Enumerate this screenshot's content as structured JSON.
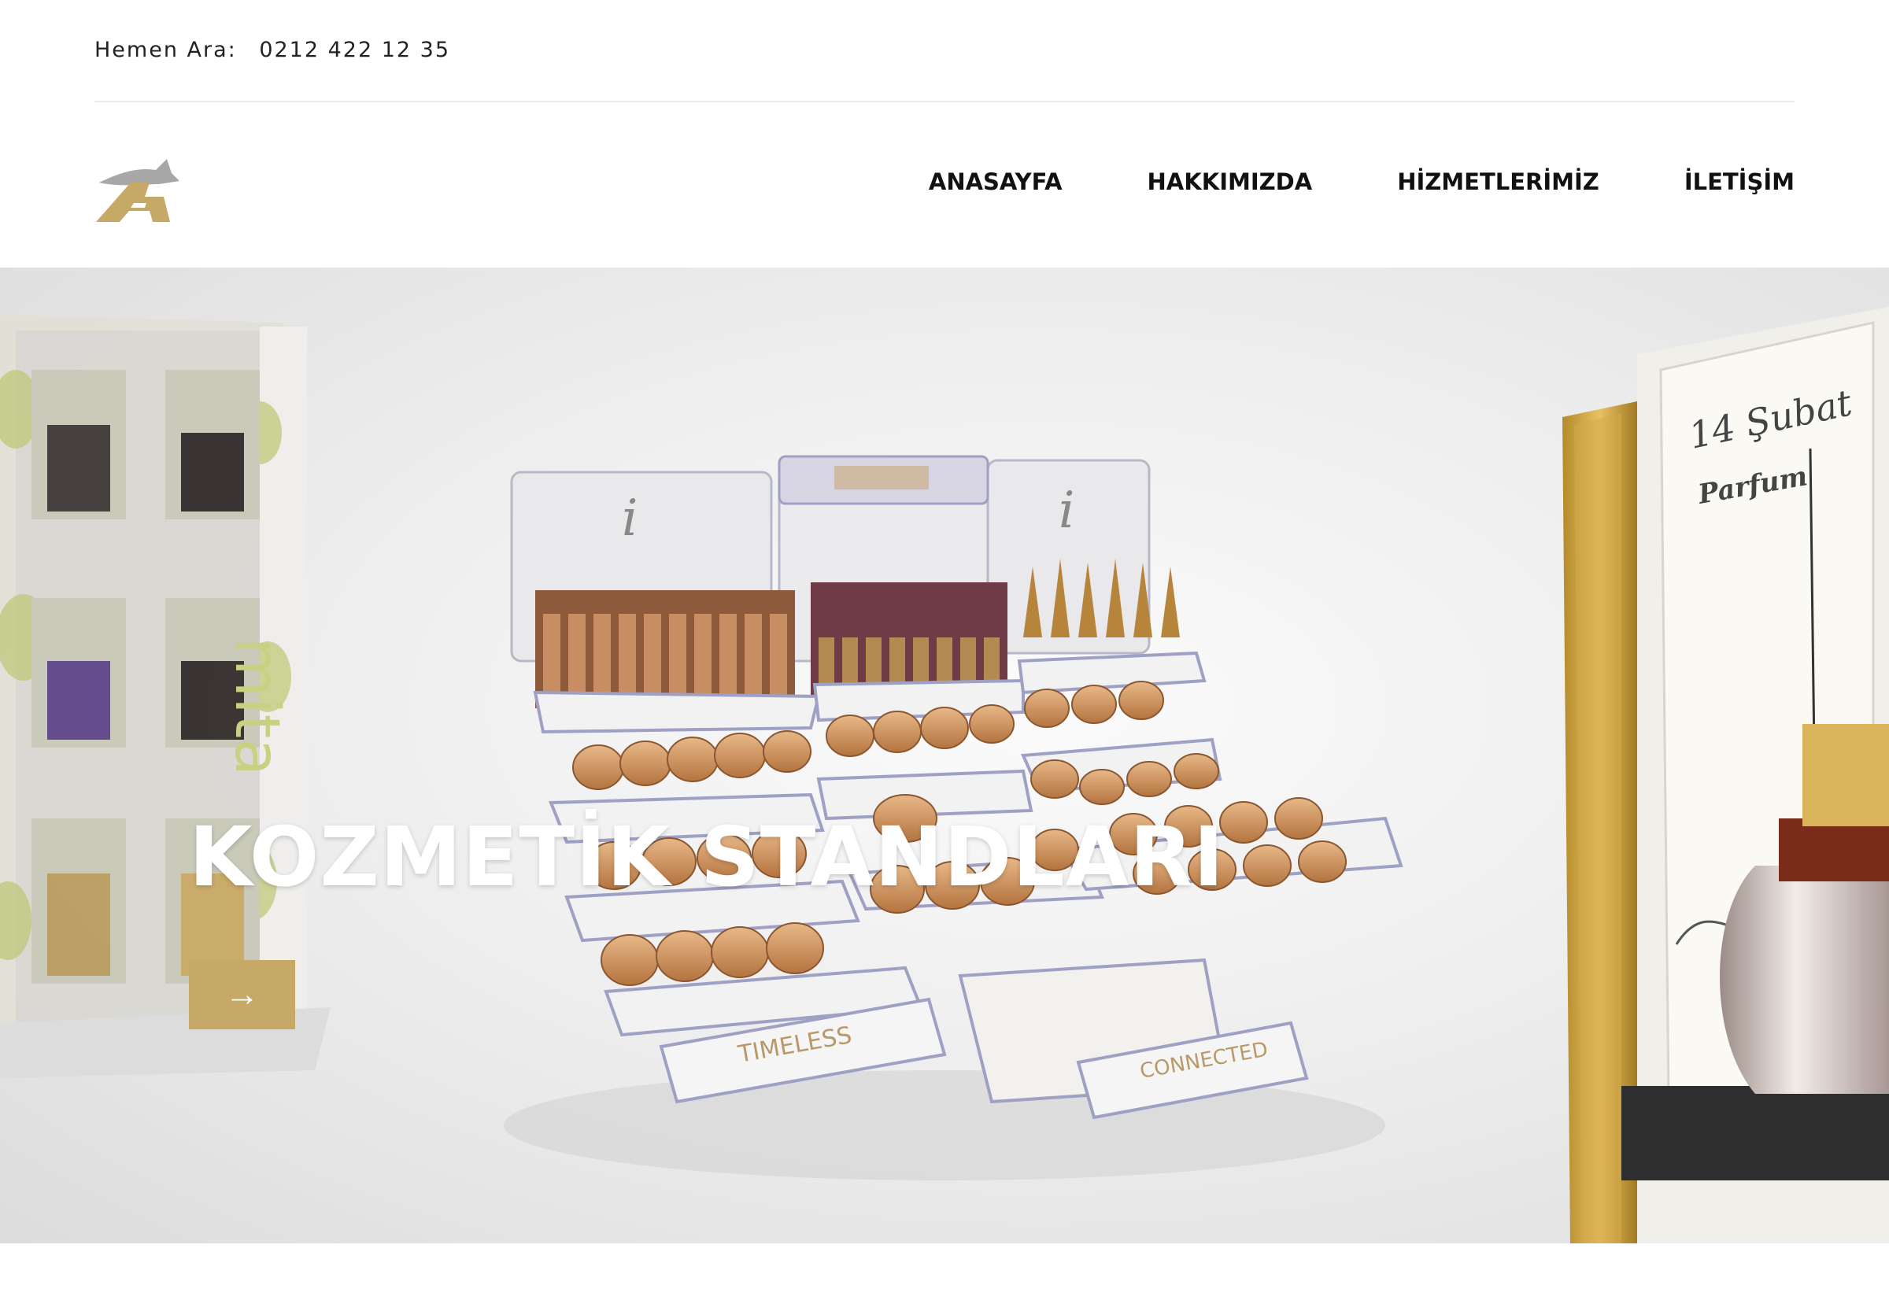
{
  "topbar": {
    "call_label": "Hemen Ara:",
    "phone": "0212 422 12 35"
  },
  "brand": {
    "logo_icon": "eagle-logo-icon",
    "colors": {
      "gold": "#c6a867",
      "grey": "#9a9a9a"
    }
  },
  "nav": {
    "items": [
      {
        "label": "ANASAYFA"
      },
      {
        "label": "HAKKIMIZDA"
      },
      {
        "label": "HİZMETLERİMİZ"
      },
      {
        "label": "İLETİŞİM"
      }
    ]
  },
  "hero": {
    "title": "KOZMETİK STANDLARI",
    "button_icon": "arrow-right-icon",
    "button_glyph": "→",
    "button_color": "#c6a867",
    "image_text": {
      "brand_left": "mita",
      "label_timeless": "TIMELESS",
      "label_connected": "CONNECTED",
      "sign_right_date": "14 Şubat",
      "sign_right_brand": "Parfum"
    }
  }
}
